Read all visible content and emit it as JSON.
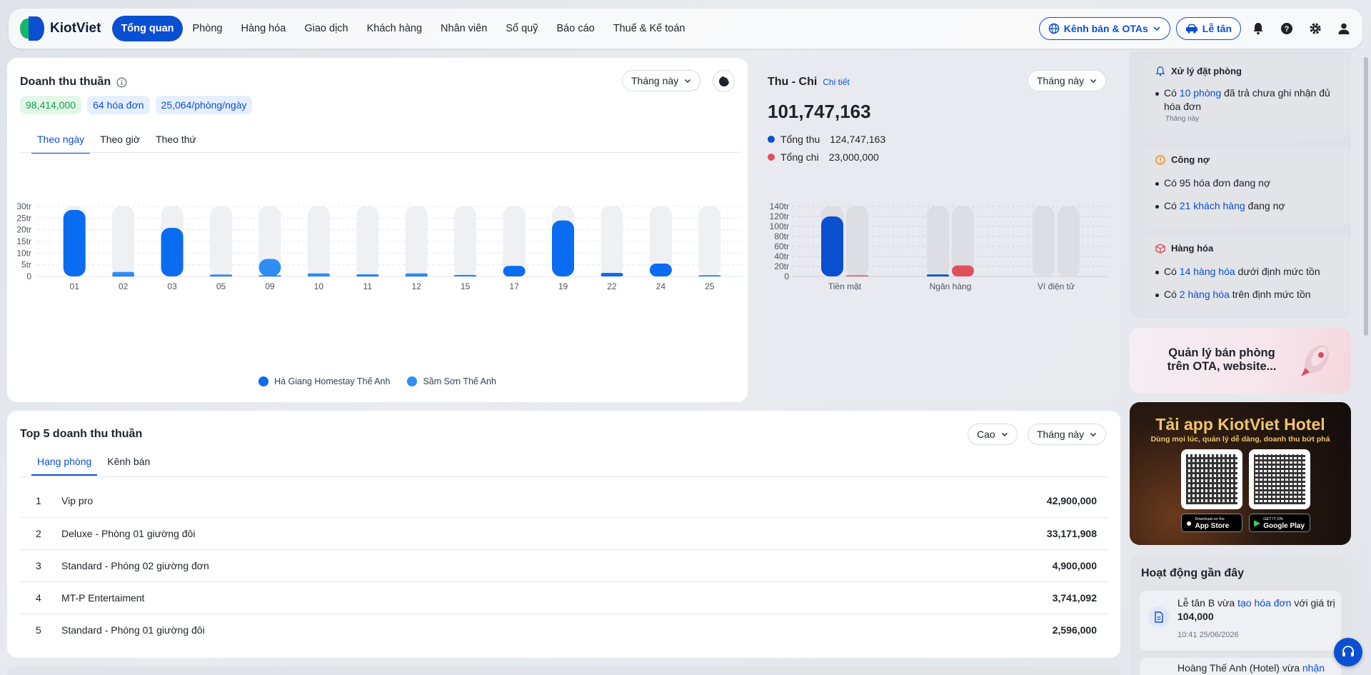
{
  "nav": {
    "brand": "KiotViet",
    "items": [
      "Tổng quan",
      "Phòng",
      "Hàng hóa",
      "Giao dịch",
      "Khách hàng",
      "Nhân viên",
      "Sổ quỹ",
      "Báo cáo",
      "Thuế & Kế toán"
    ],
    "active_index": 0,
    "channels_label": "Kênh bán & OTAs",
    "reception_label": "Lễ tân"
  },
  "revenue": {
    "title": "Doanh thu thuần",
    "period": "Tháng này",
    "stat_revenue": "98,414,000",
    "stat_invoices": "64 hóa đơn",
    "stat_per_room": "25,064/phòng/ngày",
    "tabs": [
      "Theo ngày",
      "Theo giờ",
      "Theo thứ"
    ],
    "active_tab": 0,
    "legend": [
      "Hà Giang Homestay Thế Anh",
      "Sầm Sơn Thế Anh"
    ]
  },
  "cashflow": {
    "title": "Thu - Chi",
    "detail_link": "Chi tiết",
    "period": "Tháng này",
    "total": "101,747,163",
    "income_label": "Tổng thu",
    "income_value": "124,747,163",
    "expense_label": "Tổng chi",
    "expense_value": "23,000,000"
  },
  "top5": {
    "title": "Top 5 doanh thu thuần",
    "sort": "Cao",
    "period": "Tháng này",
    "tabs": [
      "Hạng phòng",
      "Kênh bán"
    ],
    "active_tab": 0,
    "rows": [
      {
        "rank": "1",
        "name": "Vip pro",
        "value": "42,900,000"
      },
      {
        "rank": "2",
        "name": "Deluxe - Phòng 01 giường đôi",
        "value": "33,171,908"
      },
      {
        "rank": "3",
        "name": "Standard - Phòng 02 giường đơn",
        "value": "4,900,000"
      },
      {
        "rank": "4",
        "name": "MT-P Entertaiment",
        "value": "3,741,092"
      },
      {
        "rank": "5",
        "name": "Standard - Phòng 01 giường đôi",
        "value": "2,596,000"
      }
    ]
  },
  "alerts": {
    "booking": {
      "title": "Xử lý đặt phòng",
      "pre": "Có ",
      "link": "10 phòng",
      "post": " đã trả chưa ghi nhận đủ hóa đơn",
      "note": "Tháng này"
    },
    "debt": {
      "title": "Công nợ",
      "line1": "Có 95 hóa đơn đang nợ",
      "line2_pre": "Có ",
      "line2_link": "21 khách hàng",
      "line2_post": " đang nợ"
    },
    "goods": {
      "title": "Hàng hóa",
      "line1_pre": "Có ",
      "line1_link": "14 hàng hóa",
      "line1_post": " dưới định mức tồn",
      "line2_pre": "Có ",
      "line2_link": "2 hàng hóa",
      "line2_post": " trên định mức tồn"
    }
  },
  "promo_ota": {
    "line1": "Quản lý bán phòng",
    "line2": "trên OTA, website..."
  },
  "promo_app": {
    "title": "Tải app KiotViet Hotel",
    "subtitle": "Dùng mọi lúc, quản lý dễ dàng, doanh thu bứt phá",
    "appstore_small": "Download on the",
    "appstore": "App Store",
    "gplay_small": "GET IT ON",
    "gplay": "Google Play"
  },
  "activity": {
    "title": "Hoạt động gần đây",
    "item1_pre": "Lễ tân B vừa ",
    "item1_link": "tạo hóa đơn",
    "item1_mid": " với giá trị ",
    "item1_value": "104,000",
    "item1_time": "10:41 25/06/2026",
    "item2_pre": "Hoàng Thế Anh (Hotel) vừa ",
    "item2_link": "nhận"
  },
  "colors": {
    "primary": "#0b4fd1",
    "bar_blue": "#0a6cf0",
    "bar_light": "#2f8df5",
    "bar_track": "#eef0f4",
    "expense": "#e0515c",
    "success_bg": "#e3f7e8",
    "success_text": "#12a150"
  },
  "chart_data": [
    {
      "type": "bar",
      "title": "Doanh thu thuần",
      "categories": [
        "01",
        "02",
        "03",
        "05",
        "09",
        "10",
        "11",
        "12",
        "15",
        "17",
        "19",
        "22",
        "24",
        "25"
      ],
      "series": [
        {
          "name": "Hà Giang Homestay Thế Anh",
          "values": [
            28.5,
            0.3,
            20.8,
            0.2,
            0.2,
            0.1,
            0.3,
            0.3,
            0.2,
            4.5,
            24,
            1.5,
            5.5,
            0.1
          ]
        },
        {
          "name": "Sầm Sơn Thế Anh",
          "values": [
            0,
            1.6,
            0,
            0.6,
            7.3,
            1.2,
            0.6,
            1.0,
            0.4,
            0,
            0,
            0,
            0,
            0
          ]
        }
      ],
      "yticks": [
        "0",
        "5tr",
        "10tr",
        "15tr",
        "20tr",
        "25tr",
        "30tr"
      ],
      "ylim": [
        0,
        30
      ],
      "legend": "bottom"
    },
    {
      "type": "bar",
      "title": "Thu - Chi",
      "categories": [
        "Tiền mặt",
        "Ngân hàng",
        "Ví điện tử"
      ],
      "series": [
        {
          "name": "Tổng thu",
          "values": [
            120,
            4,
            0
          ]
        },
        {
          "name": "Tổng chi",
          "values": [
            1,
            22,
            0
          ]
        }
      ],
      "yticks": [
        "0",
        "20tr",
        "40tr",
        "60tr",
        "80tr",
        "100tr",
        "120tr",
        "140tr"
      ],
      "ylim": [
        0,
        140
      ]
    }
  ]
}
